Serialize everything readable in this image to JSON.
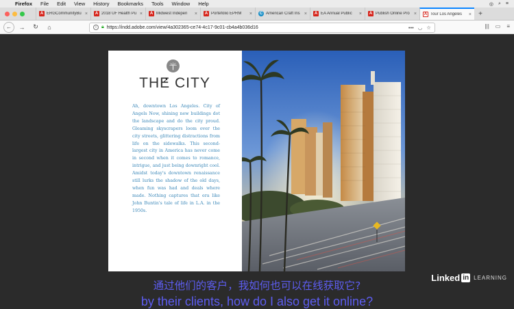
{
  "menubar": {
    "apple": "",
    "items": [
      "Firefox",
      "File",
      "Edit",
      "View",
      "History",
      "Bookmarks",
      "Tools",
      "Window",
      "Help"
    ]
  },
  "tabs": [
    {
      "label": "ERGCommunityBu",
      "favicon": "adobe",
      "favicon_glyph": "A"
    },
    {
      "label": "2018 UF Health Pu",
      "favicon": "adobe",
      "favicon_glyph": "A"
    },
    {
      "label": "Midwest Indepen",
      "favicon": "adobe",
      "favicon_glyph": "A"
    },
    {
      "label": "Portefólio EPRM",
      "favicon": "adobe",
      "favicon_glyph": "A"
    },
    {
      "label": "American Craft Ins",
      "favicon": "circle",
      "favicon_glyph": "C"
    },
    {
      "label": "EA Annual Public",
      "favicon": "adobe",
      "favicon_glyph": "A"
    },
    {
      "label": "Publish Online Pro",
      "favicon": "adobe",
      "favicon_glyph": "A"
    },
    {
      "label": "Tour Los Angeles",
      "favicon": "adobe-white",
      "favicon_glyph": "A",
      "active": true
    }
  ],
  "tab_close": "×",
  "newtab": "+",
  "nav": {
    "back": "←",
    "forward": "→",
    "reload": "↻",
    "home": "⌂",
    "url": "https://indd.adobe.com/view/4a302365-ce74-4c17-9c01-cb4a4b036d16",
    "more": "•••",
    "pocket": "◡",
    "star": "☆",
    "library": "|||",
    "sidebar": "▭",
    "menu": "≡"
  },
  "page": {
    "title": "THE CITY",
    "body": "Ah, downtown Los Angeles. City of Angels Now, shining new buildings dot the landscape and do the city proud. Gleaming skyscrapers loom over the city streets, glittering distractions from life on the sidewalks. This second-largest city in America has never come in second when it comes to romance, intrigue, and just being downright cool. Amidst today's downtown renaissance still lurks the shadow of the old days, when fun was had and deals where made. Nothing captures that era like John Buntin's tale of life in L.A. in the 1950s."
  },
  "subtitles": {
    "chinese": "通过他们的客户，我如何也可以在线获取它?",
    "english": "by their clients, how do I also get it online?"
  },
  "brand": {
    "linked": "Linked",
    "in": "in",
    "learning": "LEARNING"
  }
}
